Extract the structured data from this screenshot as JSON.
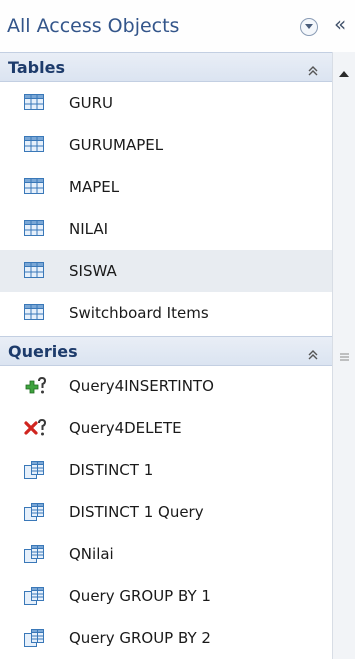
{
  "header": {
    "title": "All Access Objects",
    "collapse_label": "«"
  },
  "groups": [
    {
      "label": "Tables",
      "items": [
        {
          "label": "GURU",
          "icon": "table-icon"
        },
        {
          "label": "GURUMAPEL",
          "icon": "table-icon"
        },
        {
          "label": "MAPEL",
          "icon": "table-icon"
        },
        {
          "label": "NILAI",
          "icon": "table-icon"
        },
        {
          "label": "SISWA",
          "icon": "table-icon"
        },
        {
          "label": "Switchboard Items",
          "icon": "table-icon"
        }
      ]
    },
    {
      "label": "Queries",
      "items": [
        {
          "label": "Query4INSERTINTO",
          "icon": "append-query-icon"
        },
        {
          "label": "Query4DELETE",
          "icon": "delete-query-icon"
        },
        {
          "label": "DISTINCT 1",
          "icon": "select-query-icon"
        },
        {
          "label": "DISTINCT 1 Query",
          "icon": "select-query-icon"
        },
        {
          "label": "QNilai",
          "icon": "select-query-icon"
        },
        {
          "label": "Query GROUP BY 1",
          "icon": "select-query-icon"
        },
        {
          "label": "Query GROUP BY 2",
          "icon": "select-query-icon"
        }
      ]
    }
  ],
  "selected_item": "SISWA",
  "colors": {
    "accent": "#33558a",
    "group_header": "#dbe4f1",
    "selected": "#e8ecf1"
  }
}
